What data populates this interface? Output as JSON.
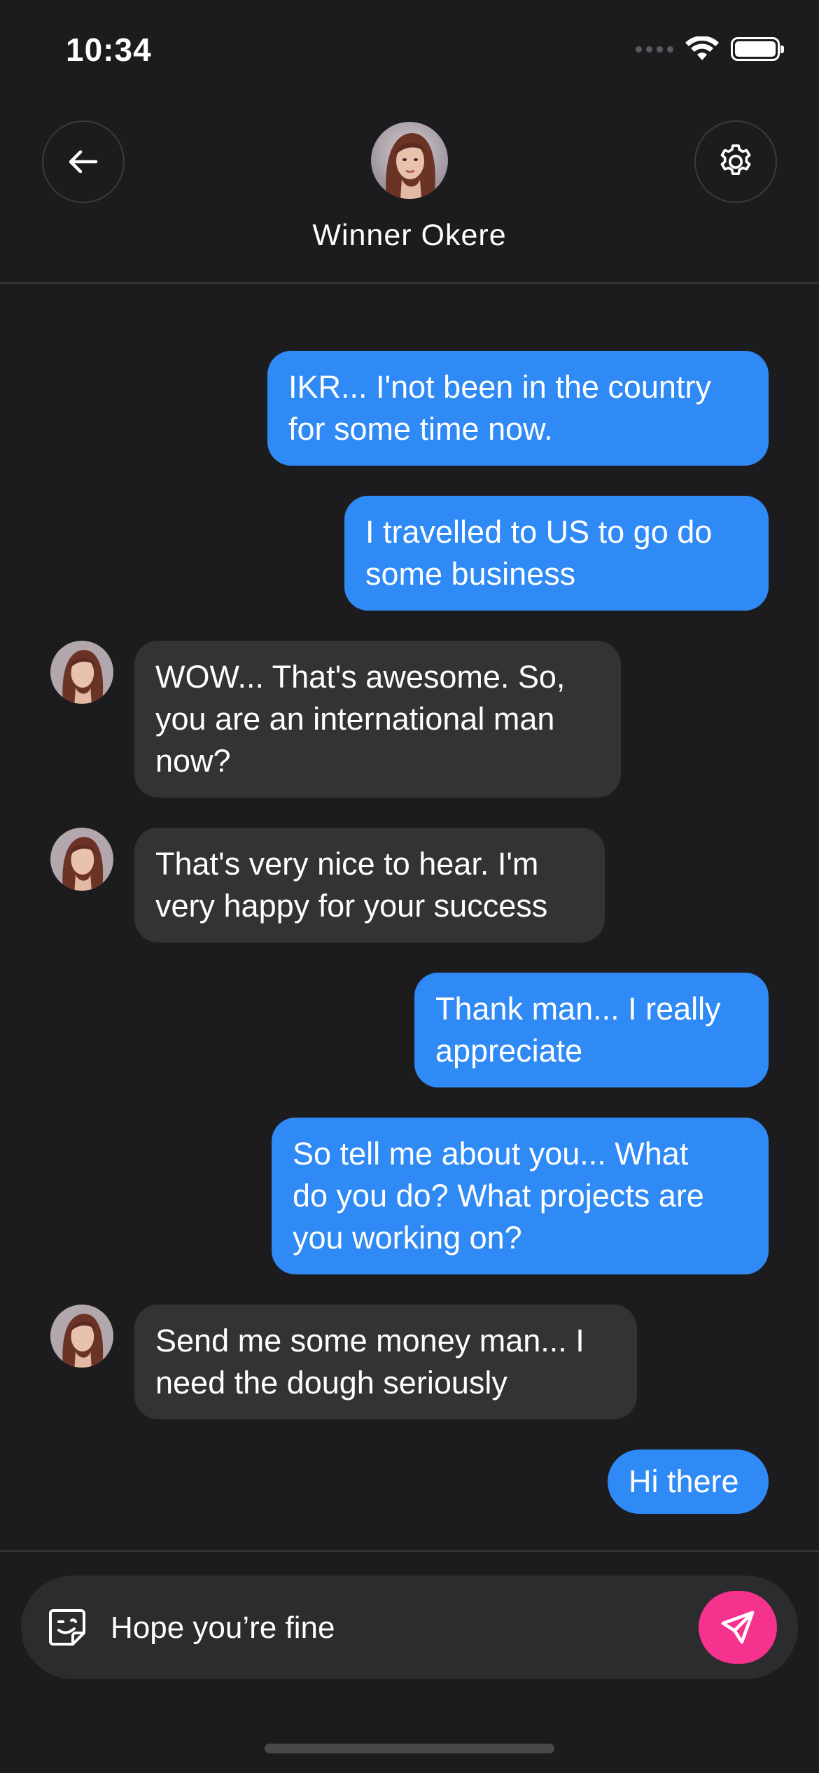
{
  "status_bar": {
    "time": "10:34"
  },
  "header": {
    "contact_name": "Winner Okere",
    "back_icon": "arrow-left-icon",
    "settings_icon": "gear-icon"
  },
  "messages": [
    {
      "direction": "out",
      "text": "IKR... I'not been in the country\nfor some time now."
    },
    {
      "direction": "out",
      "text": "I travelled to US to go do\nsome business"
    },
    {
      "direction": "in",
      "text": "WOW... That's awesome. So,\nyou are an international man\nnow?"
    },
    {
      "direction": "in",
      "text": "That's very nice to hear. I'm\nvery happy for your success"
    },
    {
      "direction": "out",
      "text": "Thank man... I really\nappreciate"
    },
    {
      "direction": "out",
      "text": "So tell me about you... What\ndo you do? What projects are\nyou working on?"
    },
    {
      "direction": "in",
      "text": "Send me some money man... I\nneed the dough seriously"
    },
    {
      "direction": "out",
      "text": "Hi there"
    }
  ],
  "composer": {
    "value": "Hope you’re fine",
    "sticker_icon": "sticker-icon",
    "send_icon": "send-icon"
  },
  "colors": {
    "background": "#1c1c1e",
    "outgoing_bubble": "#2f8af5",
    "incoming_bubble": "#333335",
    "send_button": "#f5328e"
  }
}
